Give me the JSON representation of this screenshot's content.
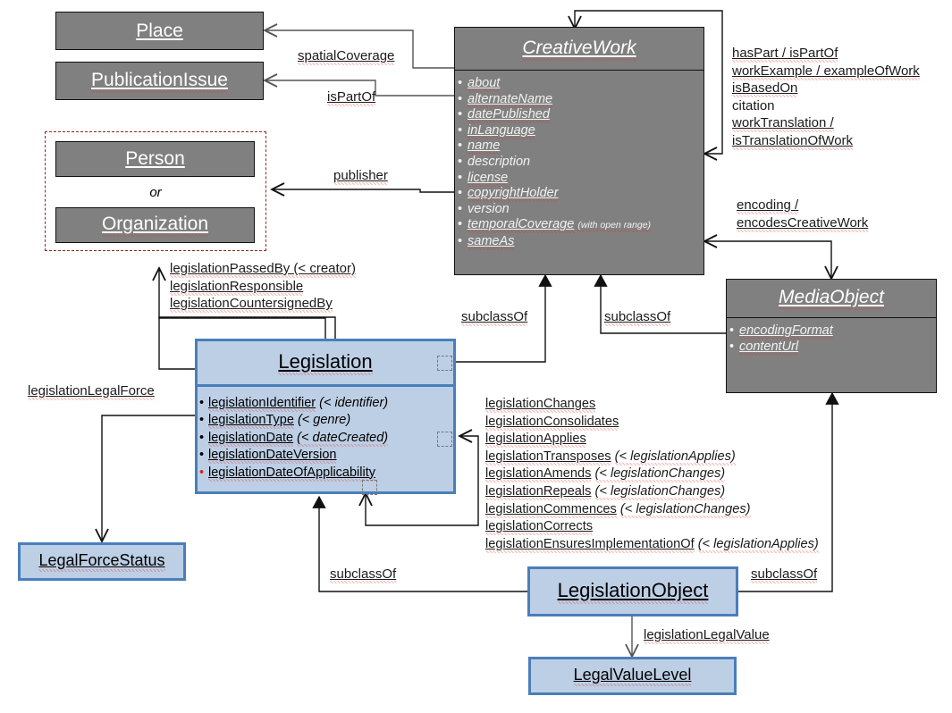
{
  "diagram": {
    "title": "Legislation / CreativeWork schema.org extension diagram",
    "colors": {
      "existing_class_fill": "#808080",
      "existing_class_stroke": "#111111",
      "new_class_fill": "#bdcfe5",
      "new_class_stroke": "#4a7ebb",
      "group_stroke": "#8b2a15",
      "required_property_bullet": "#e02020"
    }
  },
  "classes": {
    "place": {
      "name": "Place"
    },
    "publication_issue": {
      "name": "PublicationIssue"
    },
    "person": {
      "name": "Person"
    },
    "organization": {
      "name": "Organization"
    },
    "or_label": "or",
    "creative_work": {
      "name": "CreativeWork",
      "properties": [
        {
          "label": "about",
          "note": ""
        },
        {
          "label": "alternateName",
          "note": ""
        },
        {
          "label": "datePublished",
          "note": ""
        },
        {
          "label": "inLanguage",
          "note": ""
        },
        {
          "label": "name",
          "note": ""
        },
        {
          "label": "description",
          "note": ""
        },
        {
          "label": "license",
          "note": ""
        },
        {
          "label": "copyrightHolder",
          "note": ""
        },
        {
          "label": "version",
          "note": ""
        },
        {
          "label": "temporalCoverage",
          "note": "(with open range)"
        },
        {
          "label": "sameAs",
          "note": ""
        }
      ]
    },
    "media_object": {
      "name": "MediaObject",
      "properties": [
        {
          "label": "encodingFormat"
        },
        {
          "label": "contentUrl"
        }
      ]
    },
    "legislation": {
      "name": "Legislation",
      "properties": [
        {
          "label": "legislationIdentifier",
          "note": "(< identifier)",
          "required": false
        },
        {
          "label": "legislationType",
          "note": "(< genre)",
          "required": false
        },
        {
          "label": "legislationDate",
          "note": "(< dateCreated)",
          "required": false
        },
        {
          "label": "legislationDateVersion",
          "note": "",
          "required": false
        },
        {
          "label": "legislationDateOfApplicability",
          "note": "",
          "required": true
        }
      ]
    },
    "legislation_object": {
      "name": "LegislationObject"
    },
    "legal_force_status": {
      "name": "LegalForceStatus"
    },
    "legal_value_level": {
      "name": "LegalValueLevel"
    }
  },
  "edge_labels": {
    "spatial_coverage": "spatialCoverage",
    "is_part_of": "isPartOf",
    "publisher": "publisher",
    "creative_work_self": [
      "hasPart / isPartOf",
      "workExample / exampleOfWork",
      "isBasedOn",
      "citation",
      "workTranslation /",
      "isTranslationOfWork"
    ],
    "encoding": [
      "encoding /",
      "encodesCreativeWork"
    ],
    "legislation_agent": [
      "legislationPassedBy (< creator)",
      "legislationResponsible",
      "legislationCountersignedBy"
    ],
    "subclass_of_legislation": "subclassOf",
    "subclass_of_media_object": "subclassOf",
    "subclass_of_legislation_object_left": "subclassOf",
    "subclass_of_legislation_object_right": "subclassOf",
    "legislation_legal_force": "legislationLegalForce",
    "legislation_legal_value": "legislationLegalValue",
    "legislation_self": [
      {
        "label": "legislationChanges",
        "note": ""
      },
      {
        "label": "legislationConsolidates",
        "note": ""
      },
      {
        "label": "legislationApplies",
        "note": ""
      },
      {
        "label": "legislationTransposes",
        "note": "(< legislationApplies)"
      },
      {
        "label": "legislationAmends",
        "note": "(< legislationChanges)"
      },
      {
        "label": "legislationRepeals",
        "note": "(< legislationChanges)"
      },
      {
        "label": "legislationCommences",
        "note": "(< legislationChanges)"
      },
      {
        "label": "legislationCorrects",
        "note": ""
      },
      {
        "label": "legislationEnsuresImplementationOf",
        "note": "(< legislationApplies)"
      }
    ]
  }
}
